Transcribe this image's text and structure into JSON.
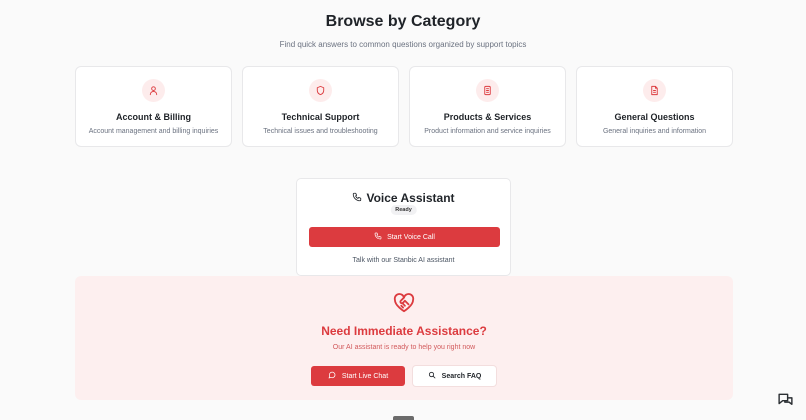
{
  "header": {
    "title": "Browse by Category",
    "subtitle": "Find quick answers to common questions organized by support topics"
  },
  "categories": [
    {
      "title": "Account & Billing",
      "description": "Account management and billing inquiries",
      "icon": "user-icon"
    },
    {
      "title": "Technical Support",
      "description": "Technical issues and troubleshooting",
      "icon": "shield-icon"
    },
    {
      "title": "Products & Services",
      "description": "Product information and service inquiries",
      "icon": "device-icon"
    },
    {
      "title": "General Questions",
      "description": "General inquiries and information",
      "icon": "document-icon"
    }
  ],
  "voice": {
    "title": "Voice Assistant",
    "status": "Ready",
    "button_label": "Start Voice Call",
    "note": "Talk with our Stanbic AI assistant"
  },
  "assist": {
    "title": "Need Immediate Assistance?",
    "subtitle": "Our AI assistant is ready to help you right now",
    "chat_label": "Start Live Chat",
    "faq_label": "Search FAQ"
  },
  "colors": {
    "accent": "#dc3b3f",
    "accent_soft": "#fdefef",
    "icon_bg": "#fdecec"
  }
}
